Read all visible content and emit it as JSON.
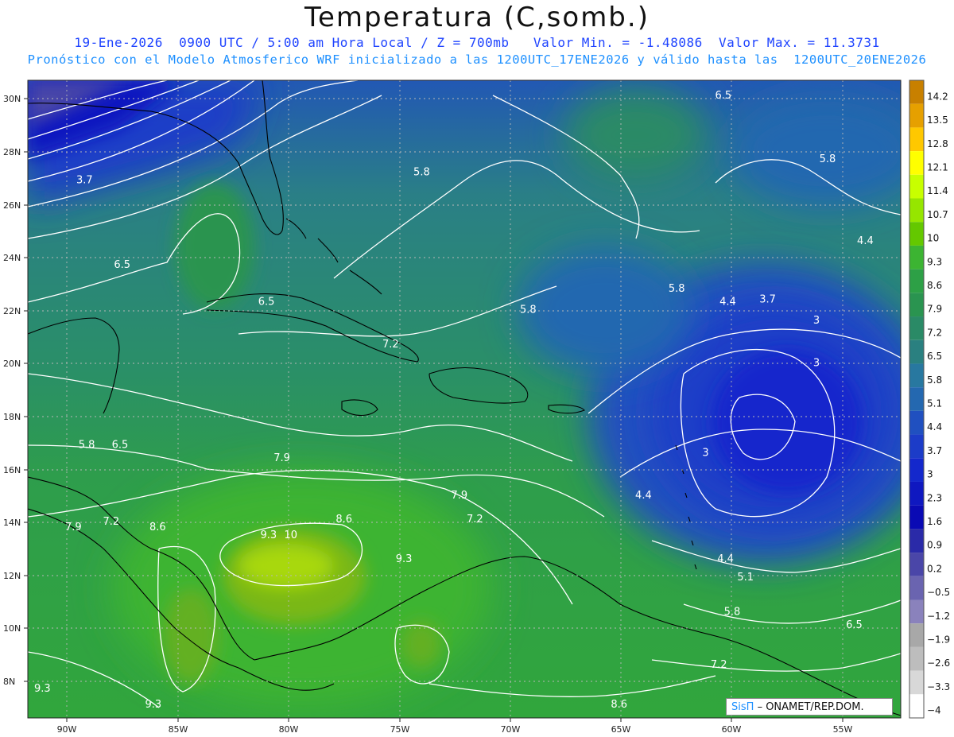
{
  "title": "Temperatura (C,somb.)",
  "subtitle_line1": "19-Ene-2026  0900 UTC / 5:00 am Hora Local / Z = 700mb   Valor Min. = -1.48086  Valor Max. = 11.3731",
  "subtitle_line2": "Pronóstico con el Modelo Atmosferico WRF inicializado a las 1200UTC_17ENE2026 y válido hasta las  1200UTC_20ENE2026",
  "credit": {
    "brand": "SisΠ",
    "text": "– ONAMET/REP.DOM."
  },
  "lat_ticks": [
    "30N",
    "28N",
    "26N",
    "24N",
    "22N",
    "20N",
    "18N",
    "16N",
    "14N",
    "12N",
    "10N",
    "8N"
  ],
  "lon_ticks": [
    "90W",
    "85W",
    "80W",
    "75W",
    "70W",
    "65W",
    "60W",
    "55W"
  ],
  "colorbar": {
    "labels": [
      "14.2",
      "13.5",
      "12.8",
      "12.1",
      "11.4",
      "10.7",
      "10",
      "9.3",
      "8.6",
      "7.9",
      "7.2",
      "6.5",
      "5.8",
      "5.1",
      "4.4",
      "3.7",
      "3",
      "2.3",
      "1.6",
      "0.9",
      "0.2",
      "−0.5",
      "−1.2",
      "−1.9",
      "−2.6",
      "−3.3",
      "−4"
    ],
    "colors": [
      "#c88000",
      "#e6a000",
      "#ffc800",
      "#ffff00",
      "#c8ff00",
      "#96e600",
      "#64c800",
      "#3cb432",
      "#2da046",
      "#2a9450",
      "#2a8a66",
      "#2a8080",
      "#2878a0",
      "#2468b0",
      "#2050c0",
      "#1c3cc8",
      "#1428cc",
      "#0f18c0",
      "#0a0ab4",
      "#2a2aa8",
      "#4a46a8",
      "#6a64b0",
      "#8a82bc",
      "#a8a8a8",
      "#bdbdbd",
      "#d8d8d8",
      "#ffffff"
    ]
  },
  "contour_labels": [
    {
      "text": "6.5",
      "lon": -60.4,
      "lat": 30.0
    },
    {
      "text": "5.8",
      "lon": -74.0,
      "lat": 27.1
    },
    {
      "text": "5.8",
      "lon": -55.7,
      "lat": 27.6
    },
    {
      "text": "3.7",
      "lon": -89.2,
      "lat": 26.8
    },
    {
      "text": "4.4",
      "lon": -54.0,
      "lat": 24.5
    },
    {
      "text": "6.5",
      "lon": -87.5,
      "lat": 23.6
    },
    {
      "text": "5.8",
      "lon": -62.5,
      "lat": 22.7
    },
    {
      "text": "6.5",
      "lon": -81.0,
      "lat": 22.2
    },
    {
      "text": "4.4",
      "lon": -60.2,
      "lat": 22.2
    },
    {
      "text": "3.7",
      "lon": -58.4,
      "lat": 22.3
    },
    {
      "text": "5.8",
      "lon": -69.2,
      "lat": 21.9
    },
    {
      "text": "3",
      "lon": -56.2,
      "lat": 21.5
    },
    {
      "text": "7.2",
      "lon": -75.4,
      "lat": 20.6
    },
    {
      "text": "3",
      "lon": -56.2,
      "lat": 19.9
    },
    {
      "text": "5.8",
      "lon": -89.1,
      "lat": 16.8
    },
    {
      "text": "6.5",
      "lon": -87.6,
      "lat": 16.8
    },
    {
      "text": "7.9",
      "lon": -80.3,
      "lat": 16.3
    },
    {
      "text": "3",
      "lon": -61.2,
      "lat": 16.5
    },
    {
      "text": "7.9",
      "lon": -72.3,
      "lat": 14.9
    },
    {
      "text": "4.4",
      "lon": -64.0,
      "lat": 14.9
    },
    {
      "text": "8.6",
      "lon": -77.5,
      "lat": 14.0
    },
    {
      "text": "7.2",
      "lon": -71.6,
      "lat": 14.0
    },
    {
      "text": "7.9",
      "lon": -89.7,
      "lat": 13.7
    },
    {
      "text": "7.2",
      "lon": -88.0,
      "lat": 13.9
    },
    {
      "text": "8.6",
      "lon": -85.9,
      "lat": 13.7
    },
    {
      "text": "9.3",
      "lon": -80.9,
      "lat": 13.4
    },
    {
      "text": "10",
      "lon": -79.9,
      "lat": 13.4
    },
    {
      "text": "9.3",
      "lon": -74.8,
      "lat": 12.5
    },
    {
      "text": "4.4",
      "lon": -60.3,
      "lat": 12.5
    },
    {
      "text": "5.1",
      "lon": -59.4,
      "lat": 11.8
    },
    {
      "text": "5.8",
      "lon": -60.0,
      "lat": 10.5
    },
    {
      "text": "6.5",
      "lon": -54.5,
      "lat": 10.0
    },
    {
      "text": "7.2",
      "lon": -60.6,
      "lat": 8.5
    },
    {
      "text": "9.3",
      "lon": -91.1,
      "lat": 7.6
    },
    {
      "text": "9.3",
      "lon": -86.1,
      "lat": 7.0
    },
    {
      "text": "8.6",
      "lon": -65.1,
      "lat": 7.0
    }
  ]
}
